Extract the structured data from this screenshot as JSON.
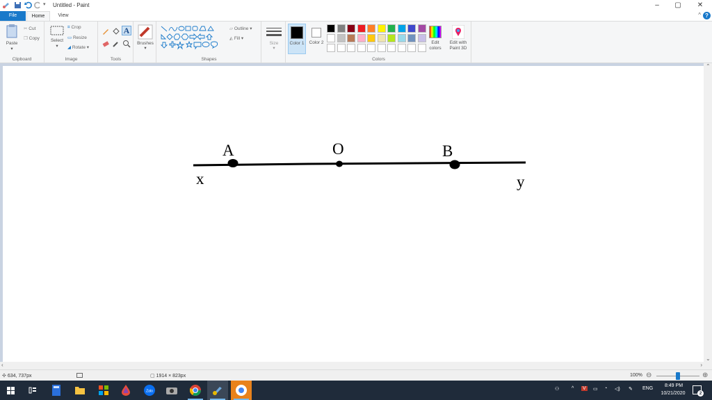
{
  "window": {
    "title": "Untitled - Paint",
    "minimize": "–",
    "maximize": "▢",
    "close": "✕"
  },
  "tabs": [
    {
      "label": "File"
    },
    {
      "label": "Home"
    },
    {
      "label": "View"
    }
  ],
  "help": "?",
  "ribbon": {
    "clipboard": {
      "paste": "Paste",
      "cut": "Cut",
      "copy": "Copy",
      "label": "Clipboard"
    },
    "image": {
      "select": "Select",
      "crop": "Crop",
      "resize": "Resize",
      "rotate": "Rotate",
      "label": "Image"
    },
    "tools": {
      "label": "Tools",
      "text_tool": "A"
    },
    "brushes": {
      "label": "Brushes"
    },
    "shapes": {
      "outline": "Outline",
      "fill": "Fill",
      "label": "Shapes"
    },
    "size": {
      "label": "Size"
    },
    "colors": {
      "color1": "Color 1",
      "color2": "Color 2",
      "edit_colors": "Edit colors",
      "edit_paint3d": "Edit with Paint 3D",
      "label": "Colors",
      "palette_row1": [
        "#000000",
        "#7f7f7f",
        "#880015",
        "#ed1c24",
        "#ff7f27",
        "#fff200",
        "#22b14c",
        "#00a2e8",
        "#3f48cc",
        "#a349a4"
      ],
      "palette_row2": [
        "#ffffff",
        "#c3c3c3",
        "#b97a57",
        "#ffaec9",
        "#ffc90e",
        "#efe4b0",
        "#b5e61d",
        "#99d9ea",
        "#7092be",
        "#c8bfe7"
      ]
    }
  },
  "drawing": {
    "label_x": "x",
    "label_y": "y",
    "label_a": "A",
    "label_o": "O",
    "label_b": "B"
  },
  "status": {
    "cursor": "634, 737px",
    "size": "1914 × 823px",
    "zoom": "100%",
    "zoom_fraction": 0.5
  },
  "taskbar": {
    "lang": "ENG",
    "time": "8:49 PM",
    "date": "10/21/2020",
    "notifications": "2"
  }
}
